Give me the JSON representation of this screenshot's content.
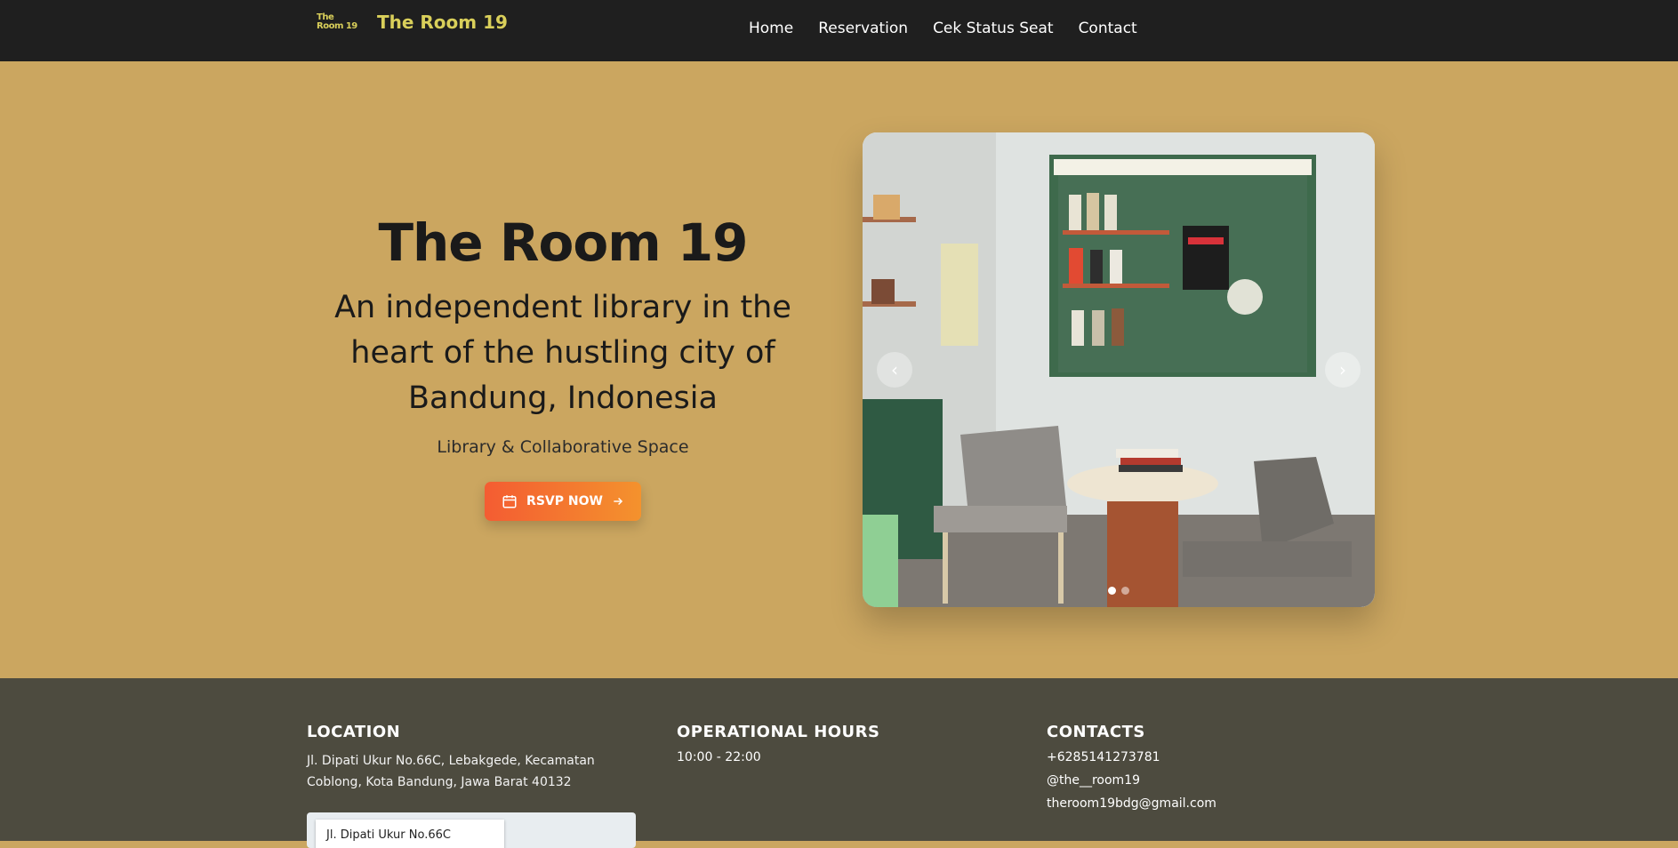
{
  "navbar": {
    "logo_line1": "The",
    "logo_line2": "Room 19",
    "brand": "The Room 19",
    "links": [
      "Home",
      "Reservation",
      "Cek Status Seat",
      "Contact"
    ]
  },
  "hero": {
    "title": "The Room 19",
    "subtitle": "An independent library in the heart of the hustling city of Bandung, Indonesia",
    "tagline": "Library & Collaborative Space",
    "rsvp_label": "RSVP NOW",
    "carousel": {
      "prev_icon": "chevron-left-icon",
      "next_icon": "chevron-right-icon",
      "slide_count": 2,
      "active_slide": 1
    }
  },
  "footer": {
    "location": {
      "heading": "LOCATION",
      "address": "Jl. Dipati Ukur No.66C, Lebakgede, Kecamatan Coblong, Kota Bandung, Jawa Barat 40132",
      "map_label": "Jl. Dipati Ukur No.66C"
    },
    "hours": {
      "heading": "OPERATIONAL HOURS",
      "value": "10:00 - 22:00"
    },
    "contacts": {
      "heading": "CONTACTS",
      "phone": "+6285141273781",
      "instagram": "@the__room19",
      "email": "theroom19bdg@gmail.com"
    }
  },
  "colors": {
    "navbar_bg": "#1f1f1f",
    "brand_yellow": "#d9cf5a",
    "hero_bg": "#cba660",
    "footer_bg": "#4d4b3f",
    "button_start": "#f45c32",
    "button_end": "#f4922d"
  }
}
